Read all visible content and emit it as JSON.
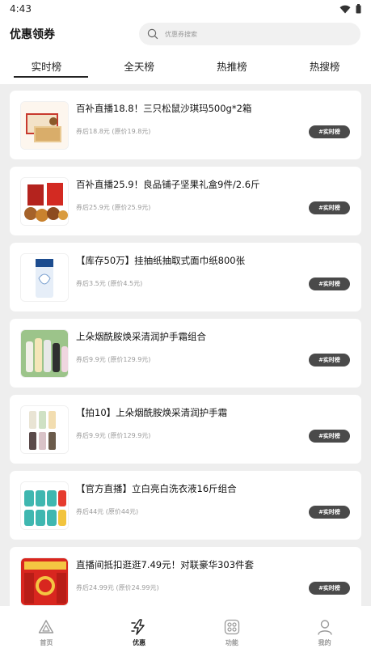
{
  "status_bar": {
    "time": "4:43"
  },
  "header": {
    "title": "优惠领券",
    "search_placeholder": "优惠券搜索"
  },
  "tabs": [
    {
      "label": "实时榜",
      "active": true
    },
    {
      "label": "全天榜",
      "active": false
    },
    {
      "label": "热推榜",
      "active": false
    },
    {
      "label": "热搜榜",
      "active": false
    }
  ],
  "items": [
    {
      "title": "百补直播18.8！三只松鼠沙琪玛500g*2箱",
      "price": "券后18.8元 (原价19.8元)",
      "badge": "#实时榜"
    },
    {
      "title": "百补直播25.9！良品铺子坚果礼盒9件/2.6斤",
      "price": "券后25.9元 (原价25.9元)",
      "badge": "#实时榜"
    },
    {
      "title": "【库存50万】挂抽纸抽取式面巾纸800张",
      "price": "券后3.5元 (原价4.5元)",
      "badge": "#实时榜"
    },
    {
      "title": "上朵烟酰胺焕采清润护手霜组合",
      "price": "券后9.9元 (原价129.9元)",
      "badge": "#实时榜"
    },
    {
      "title": "【拍10】上朵烟酰胺焕采清润护手霜",
      "price": "券后9.9元 (原价129.9元)",
      "badge": "#实时榜"
    },
    {
      "title": "【官方直播】立白亮白洗衣液16斤组合",
      "price": "券后44元 (原价44元)",
      "badge": "#实时榜"
    },
    {
      "title": "直播间抵扣逛逛7.49元！对联豪华303件套",
      "price": "券后24.99元 (原价24.99元)",
      "badge": "#实时榜"
    }
  ],
  "bottom_nav": [
    {
      "label": "首页",
      "icon": "home-triangle-icon",
      "active": false
    },
    {
      "label": "优惠",
      "icon": "lightning-icon",
      "active": true
    },
    {
      "label": "功能",
      "icon": "function-grid-icon",
      "active": false
    },
    {
      "label": "我的",
      "icon": "person-icon",
      "active": false
    }
  ]
}
